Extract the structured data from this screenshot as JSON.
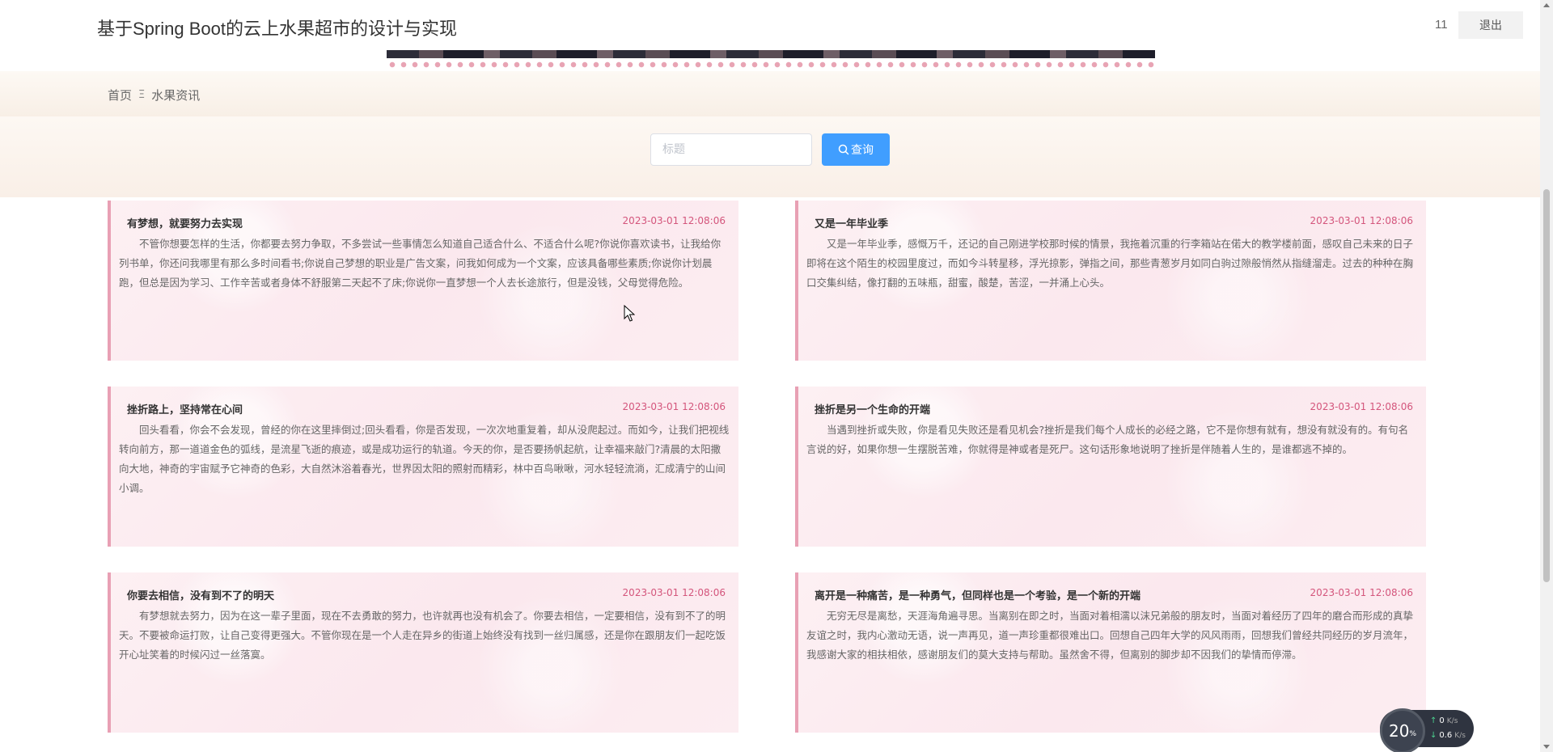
{
  "header": {
    "site_title": "基于Spring Boot的云上水果超市的设计与实现",
    "user_name": "11",
    "logout_label": "退出"
  },
  "breadcrumb": {
    "home": "首页",
    "separator": "Ξ",
    "current": "水果资讯"
  },
  "search": {
    "placeholder": "标题",
    "value": "",
    "button_label": "查询"
  },
  "news": [
    {
      "title": "有梦想，就要努力去实现",
      "date": "2023-03-01 12:08:06",
      "body": "不管你想要怎样的生活，你都要去努力争取，不多尝试一些事情怎么知道自己适合什么、不适合什么呢?你说你喜欢读书，让我给你列书单，你还问我哪里有那么多时间看书;你说自己梦想的职业是广告文案，问我如何成为一个文案，应该具备哪些素质;你说你计划晨跑，但总是因为学习、工作辛苦或者身体不舒服第二天起不了床;你说你一直梦想一个人去长途旅行，但是没钱，父母觉得危险。"
    },
    {
      "title": "又是一年毕业季",
      "date": "2023-03-01 12:08:06",
      "body": "又是一年毕业季，感慨万千，还记的自己刚进学校那时候的情景，我拖着沉重的行李箱站在偌大的教学楼前面，感叹自己未来的日子即将在这个陌生的校园里度过，而如今斗转星移，浮光掠影，弹指之间，那些青葱岁月如同白驹过隙般悄然从指缝溜走。过去的种种在胸口交集纠结，像打翻的五味瓶，甜蜜，酸楚，苦涩，一并涌上心头。"
    },
    {
      "title": "挫折路上，坚持常在心间",
      "date": "2023-03-01 12:08:06",
      "body": "回头看看，你会不会发现，曾经的你在这里摔倒过;回头看看，你是否发现，一次次地重复着，却从没爬起过。而如今，让我们把视线转向前方，那一道道金色的弧线，是流星飞逝的痕迹，或是成功运行的轨道。今天的你，是否要扬帆起航，让幸福来敲门?清晨的太阳撒向大地，神奇的宇宙赋予它神奇的色彩，大自然沐浴着春光，世界因太阳的照射而精彩，林中百鸟啾啾，河水轻轻流淌，汇成清宁的山间小调。"
    },
    {
      "title": "挫折是另一个生命的开端",
      "date": "2023-03-01 12:08:06",
      "body": "当遇到挫折或失败，你是看见失败还是看见机会?挫折是我们每个人成长的必经之路，它不是你想有就有，想没有就没有的。有句名言说的好，如果你想一生摆脱苦难，你就得是神或者是死尸。这句话形象地说明了挫折是伴随着人生的，是谁都逃不掉的。"
    },
    {
      "title": "你要去相信，没有到不了的明天",
      "date": "2023-03-01 12:08:06",
      "body": "有梦想就去努力，因为在这一辈子里面，现在不去勇敢的努力，也许就再也没有机会了。你要去相信，一定要相信，没有到不了的明天。不要被命运打败，让自己变得更强大。不管你现在是一个人走在异乡的街道上始终没有找到一丝归属感，还是你在跟朋友们一起吃饭开心址笑着的时候闪过一丝落寞。"
    },
    {
      "title": "离开是一种痛苦，是一种勇气，但同样也是一个考验，是一个新的开端",
      "date": "2023-03-01 12:08:06",
      "body": "无穷无尽是离愁，天涯海角遍寻思。当离别在即之时，当面对着相濡以沫兄弟般的朋友时，当面对着经历了四年的磨合而形成的真挚友谊之时，我内心激动无语，说一声再见，道一声珍重都很难出口。回想自己四年大学的风风雨雨，回想我们曾经共同经历的岁月流年，我感谢大家的相扶相依，感谢朋友们的莫大支持与帮助。虽然舍不得，但离别的脚步却不因我们的挚情而停滞。"
    }
  ],
  "net_widget": {
    "percent": "20",
    "percent_unit": "%",
    "upload": "0",
    "upload_unit": "K/s",
    "download": "0.6",
    "download_unit": "K/s"
  },
  "colors": {
    "accent": "#409eff",
    "date": "#d4557c",
    "card_border": "#e8a0b4"
  }
}
